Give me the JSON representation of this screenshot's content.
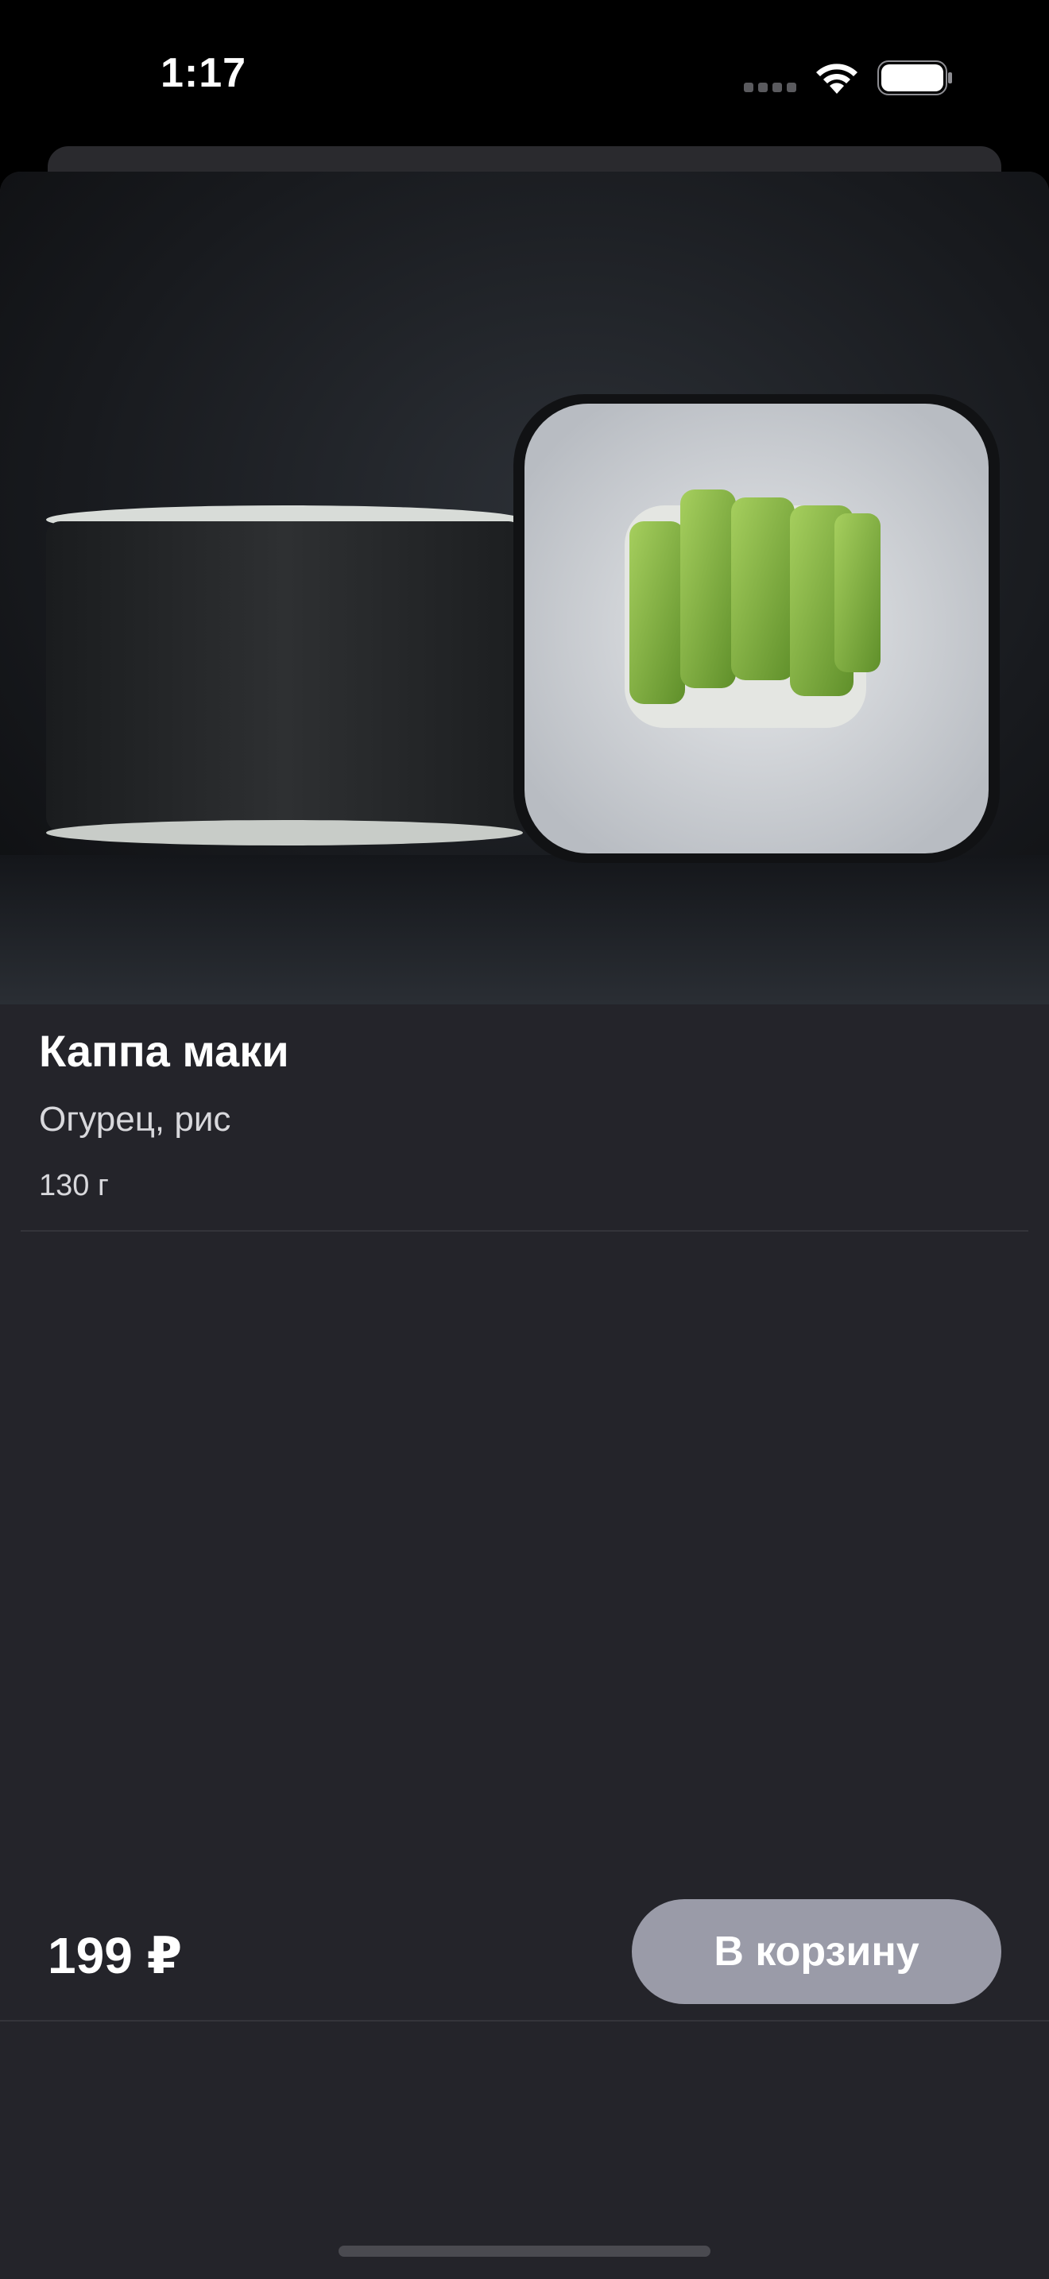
{
  "status_bar": {
    "time": "1:17",
    "icons": [
      "cellular-signal-icon",
      "wifi-icon",
      "battery-icon"
    ]
  },
  "product": {
    "title": "Каппа маки",
    "description": "Огурец, рис",
    "weight": "130 г",
    "image": "sushi-roll-photo"
  },
  "footer": {
    "price": "199 ₽",
    "cart_button_label": "В корзину"
  },
  "colors": {
    "background": "#000000",
    "sheet": "#24242a",
    "cart_button": "#9a9ba8",
    "text": "#ffffff"
  }
}
